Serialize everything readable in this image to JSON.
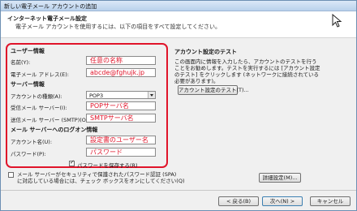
{
  "window": {
    "title": "新しい電子メール アカウントの追加"
  },
  "header": {
    "title": "インターネット電子メール設定",
    "subtitle": "電子メール アカウントを使用するには、以下の項目をすべて設定してください。"
  },
  "user_info": {
    "heading": "ユーザー情報",
    "name_label": "名前(Y):",
    "name_value": "任意の名称",
    "email_label": "電子メール アドレス(E):",
    "email_value": "abcde@fghujk.jp"
  },
  "server_info": {
    "heading": "サーバー情報",
    "account_type_label": "アカウントの種類(A):",
    "account_type_value": "POP3",
    "incoming_label": "受信メール サーバー(I):",
    "incoming_value": "POPサーバ名",
    "outgoing_label": "送信メール サーバー (SMTP)(O):",
    "outgoing_value": "SMTPサーバ名"
  },
  "login_info": {
    "heading": "メール サーバーへのログオン情報",
    "account_label": "アカウント名(U):",
    "account_value": "設定書のユーザー名",
    "password_label": "パスワード(P):",
    "password_value": "パスワード",
    "remember_label": "パスワードを保存する(R)",
    "remember_checked": true
  },
  "test": {
    "heading": "アカウント設定のテスト",
    "description": "この画面内に情報を入力したら、アカウントのテストを行うことをお勧めします。テストを実行するには [アカウント設定のテスト] をクリックします (ネットワークに接続されている必要があります)。",
    "button_label": "アカウント設定のテスト(T)..."
  },
  "spa": {
    "line1": "メール サーバーがセキュリティで保護されたパスワード認証 (SPA)",
    "line2": "に対応している場合には、チェック ボックスをオンにしてください(Q)",
    "checked": false
  },
  "buttons": {
    "more_settings": "詳細設定(M)...",
    "back": "< 戻る(B)",
    "next": "次へ(N) >",
    "cancel": "キャンセル"
  }
}
